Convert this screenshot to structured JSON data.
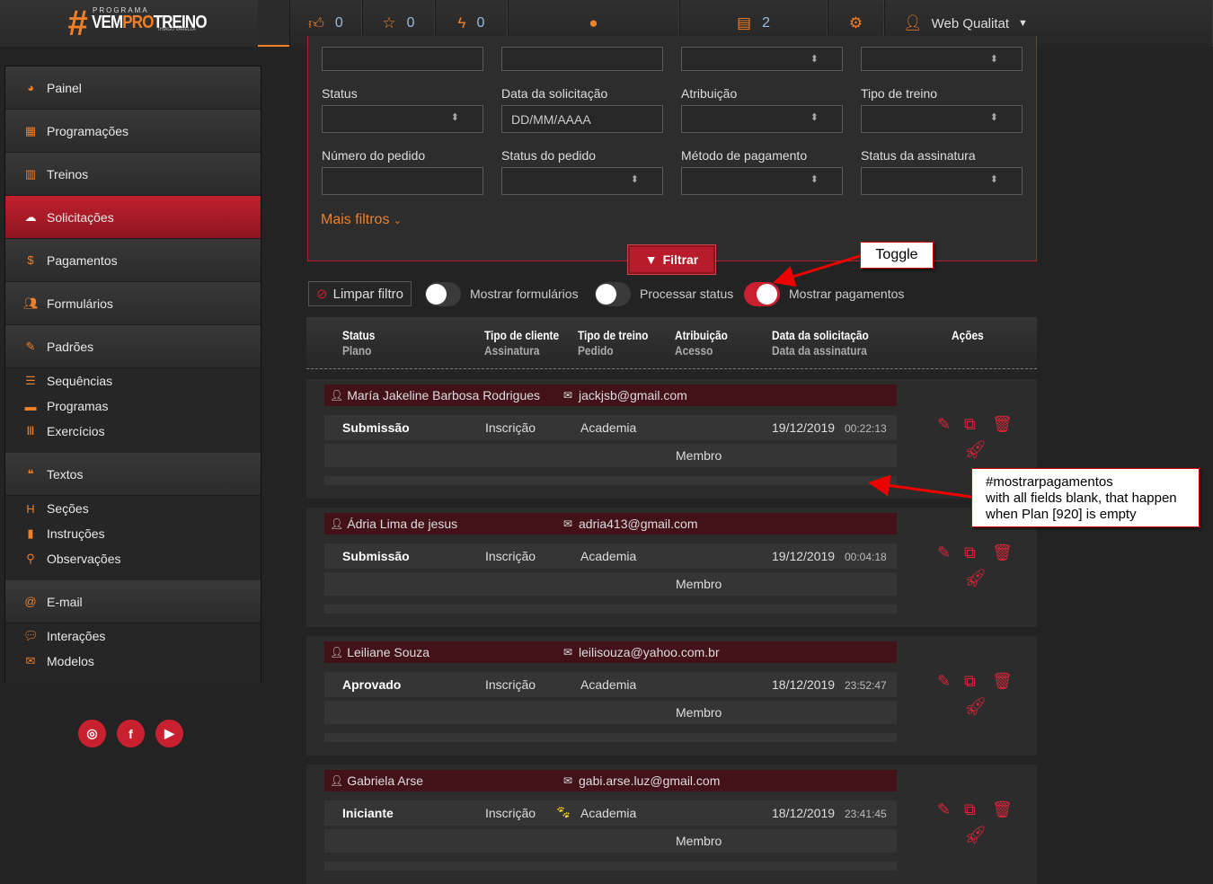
{
  "header": {
    "logo": {
      "line1": "PROGRAMA",
      "vem": "VEM",
      "pro": "PRO",
      "treino": "TREINO",
      "author": "THIAGO VARELLA"
    },
    "likes": "0",
    "stars": "0",
    "bolts": "0",
    "docs": "2",
    "user": "Web Qualitat"
  },
  "sidebar": {
    "items": [
      "Painel",
      "Programações",
      "Treinos",
      "Solicitações",
      "Pagamentos",
      "Formulários",
      "Padrões",
      "Sequências",
      "Programas",
      "Exercícios",
      "Textos",
      "Seções",
      "Instruções",
      "Observações",
      "E-mail",
      "Interações",
      "Modelos"
    ],
    "active": "Solicitações"
  },
  "filters": {
    "labels": [
      "Status",
      "Data da solicitação",
      "Atribuição",
      "Tipo de treino",
      "Número do pedido",
      "Status do pedido",
      "Método de pagamento",
      "Status da assinatura"
    ],
    "date_placeholder": "DD/MM/AAAA",
    "more": "Mais filtros",
    "filter_button": "Filtrar"
  },
  "toolbar": {
    "clear": "Limpar filtro",
    "toggles": [
      {
        "label": "Mostrar formulários",
        "on": false
      },
      {
        "label": "Processar status",
        "on": false
      },
      {
        "label": "Mostrar pagamentos",
        "on": true
      }
    ]
  },
  "table": {
    "headers": [
      [
        "Status",
        "Plano"
      ],
      [
        "Tipo de cliente",
        "Assinatura"
      ],
      [
        "Tipo de treino",
        "Pedido"
      ],
      [
        "Atribuição",
        "Acesso"
      ],
      [
        "Data da solicitação",
        "Data da assinatura"
      ],
      [
        "Ações",
        ""
      ]
    ],
    "records": [
      {
        "name": "María Jakeline Barbosa Rodrigues",
        "email": "jackjsb@gmail.com",
        "status": "Submissão",
        "client": "Inscrição",
        "type": "Academia",
        "date": "19/12/2019",
        "time": "00:22:13",
        "access": "Membro"
      },
      {
        "name": "Ádria Lima de jesus",
        "email": "adria413@gmail.com",
        "status": "Submissão",
        "client": "Inscrição",
        "type": "Academia",
        "date": "19/12/2019",
        "time": "00:04:18",
        "access": "Membro"
      },
      {
        "name": "Leiliane Souza",
        "email": "leilisouza@yahoo.com.br",
        "status": "Aprovado",
        "client": "Inscrição",
        "type": "Academia",
        "date": "18/12/2019",
        "time": "23:52:47",
        "access": "Membro"
      },
      {
        "name": "Gabriela Arse",
        "email": "gabi.arse.luz@gmail.com",
        "status": "Iniciante",
        "client": "Inscrição",
        "type": "Academia",
        "date": "18/12/2019",
        "time": "23:41:45",
        "access": "Membro"
      }
    ]
  },
  "annotations": {
    "toggle": "Toggle",
    "note": [
      "#mostrarpagamentos",
      "with all fields blank, that happen",
      "when Plan [920] is empty"
    ]
  }
}
